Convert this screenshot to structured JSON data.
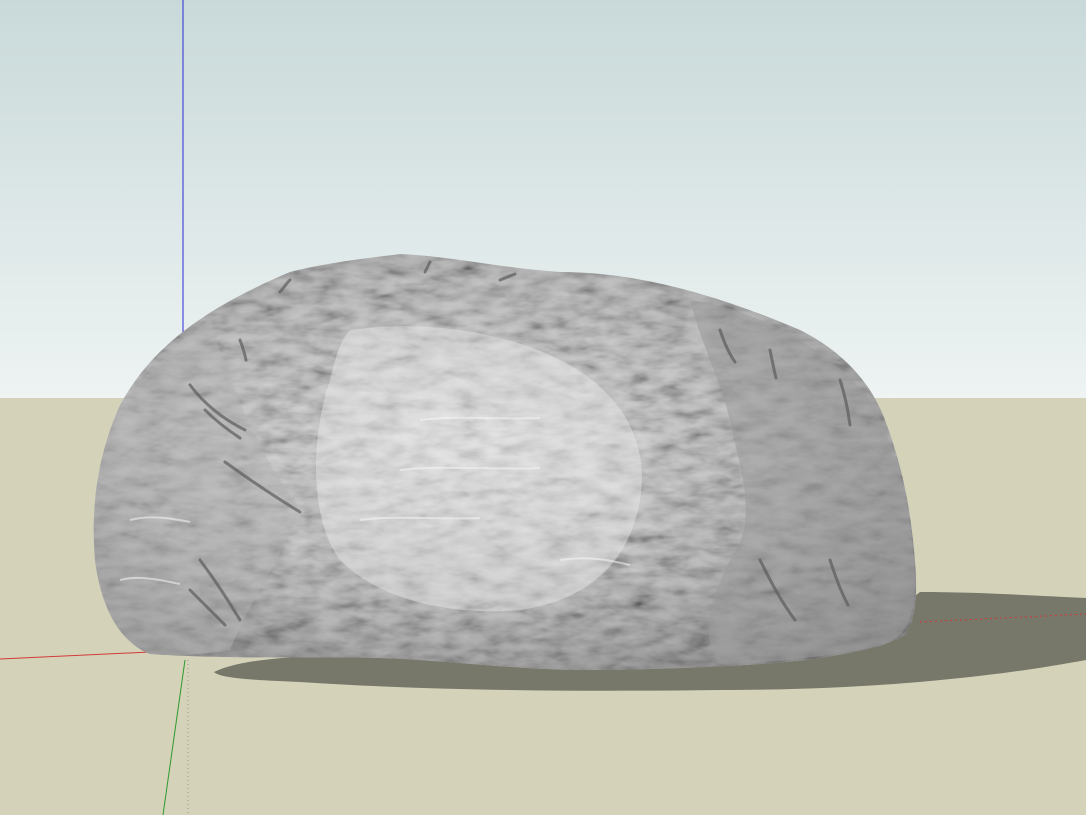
{
  "scene": {
    "sky_top_color": "#c9d9d9",
    "sky_horizon_color": "#eef3f3",
    "ground_color": "#d4d2b9",
    "shadow_color": "#77776a",
    "rock_light_color": "#e6e6e6",
    "rock_mid_color": "#a9a9a9",
    "rock_dark_color": "#6f6f6f"
  },
  "axes": {
    "red_axis_color": "#d23a3a",
    "green_axis_color": "#2f9a2f",
    "blue_axis_color": "#2b2bd8"
  },
  "model": {
    "name_icon": "boulder-model"
  }
}
